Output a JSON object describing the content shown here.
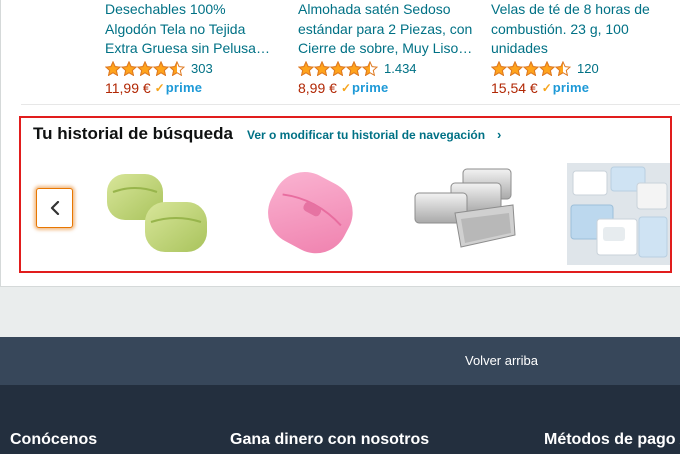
{
  "products": [
    {
      "title_lines": [
        "Desechables 100%",
        "Algodón Tela no Tejida",
        "Extra Gruesa sin Pelusa…"
      ],
      "rating": 4.5,
      "reviews": "303",
      "price": "11,99 €",
      "prime": "prime"
    },
    {
      "title_lines": [
        "Almohada satén Sedoso",
        "estándar para 2 Piezas, con",
        "Cierre de sobre, Muy Liso…"
      ],
      "rating": 4.5,
      "reviews": "1.434",
      "price": "8,99 €",
      "prime": "prime"
    },
    {
      "title_lines": [
        "Velas de té de 8 horas de",
        "combustión. 23 g, 100",
        "unidades"
      ],
      "rating": 4.5,
      "reviews": "120",
      "price": "15,54 €",
      "prime": "prime"
    }
  ],
  "history": {
    "title": "Tu historial de búsqueda",
    "link": "Ver o modificar tu historial de navegación",
    "link_chevron": "›",
    "prev_icon": "chevron-left-icon",
    "items": [
      "green-soap-boxes",
      "pink-soap-box",
      "silver-tin-boxes",
      "soap-boxes-set"
    ]
  },
  "footer": {
    "back_to_top": "Volver arriba",
    "columns": [
      "Conócenos",
      "Gana dinero con nosotros",
      "Métodos de pago A"
    ]
  },
  "colors": {
    "link": "#007185",
    "price": "#b12704",
    "star": "#ffa41c",
    "prime": "#1d99d7",
    "highlight_border": "#e11d1d",
    "footer_top": "#37475a",
    "footer": "#232f3e"
  }
}
